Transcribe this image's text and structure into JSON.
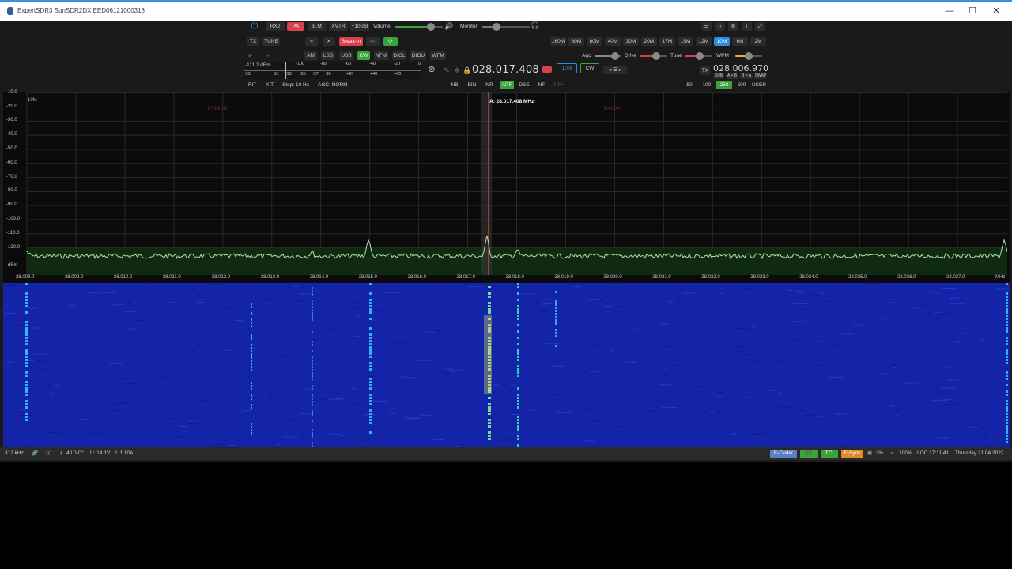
{
  "window": {
    "title": "ExpertSDR3 SunSDR2DX EED06121000318",
    "minimize": "—",
    "maximize": "☐",
    "close": "✕"
  },
  "row1": {
    "rx2": "RX2",
    "pa": "PA",
    "bm": "B.M",
    "xvtr": "XVTR",
    "db": "+10 dB",
    "volume_label": "Volume",
    "volume_level": 0.75,
    "monitor_label": "Monitor",
    "monitor_level": 0.3
  },
  "row2": {
    "tx": "TX",
    "tune": "TUNE",
    "breakin": "Break-in",
    "bands": [
      "160M",
      "80M",
      "60M",
      "40M",
      "30M",
      "20M",
      "17M",
      "15M",
      "12M",
      "10M",
      "6M",
      "2M"
    ],
    "active_band": "10M"
  },
  "row3": {
    "modes": [
      "AM",
      "LSB",
      "USB",
      "CW",
      "NFM",
      "DIGL",
      "DIGU",
      "WFM"
    ],
    "active_mode": "CW",
    "agc_label": "Agc",
    "agc_level": 0.75,
    "drive_label": "Drive",
    "drive_level": 0.6,
    "tune_label": "Tune",
    "tune_level": 0.55,
    "wpm_label": "WPM",
    "wpm_level": 0.5
  },
  "meter": {
    "dbm": "-111.2 dBm",
    "top_scale": [
      "-100",
      "-80",
      "-60",
      "-40",
      "-20",
      "0"
    ],
    "bottom_scale": [
      "S3",
      "S1",
      "S3",
      "S5",
      "S7",
      "S9",
      "+20",
      "+40",
      "+60"
    ]
  },
  "vfo_a": {
    "freq": "028.017.408",
    "band": "10M",
    "mode": "CW"
  },
  "vfo_b": {
    "freq": "028.006.970",
    "sub": "SUB",
    "ab": "A > B",
    "ba": "B > A",
    "swap": "SWAP",
    "tx": "TX"
  },
  "row4": {
    "rit": "RIT",
    "xit": "XIT",
    "step": "Step: 10 Hz",
    "agc": "AGC: NORM",
    "filters": [
      "NB",
      "BIN",
      "NR",
      "APF",
      "DSE",
      "NF",
      "NF+"
    ],
    "active_filter": "APF",
    "bandwidths": [
      "50",
      "100",
      "250",
      "500",
      "USER"
    ],
    "active_bandwidth": "250"
  },
  "spectrum": {
    "band_label": "10M",
    "marker": "A: 28.017.408 MHz",
    "left_tag": "PY1SUN",
    "right_tag": "DA0DX",
    "unit": "dBm",
    "mhz": "MHz",
    "y_ticks": [
      "-10.0",
      "-20.0",
      "-30.0",
      "-40.0",
      "-50.0",
      "-60.0",
      "-70.0",
      "-80.0",
      "-90.0",
      "-100.0",
      "-110.0",
      "-120.0"
    ],
    "x_ticks": [
      "28.008.0",
      "28.009.0",
      "28.010.0",
      "28.011.0",
      "28.012.0",
      "28.013.0",
      "28.014.0",
      "28.015.0",
      "28.016.0",
      "28.017.0",
      "28.018.0",
      "28.019.0",
      "28.020.0",
      "28.021.0",
      "28.022.0",
      "28.023.0",
      "28.024.0",
      "28.025.0",
      "28.026.0",
      "28.027.0"
    ]
  },
  "status": {
    "span": "312 kHz",
    "temp": "40.0 C°",
    "voltage": "U: 14.1V",
    "current": "I: 1.10A",
    "ecoder": "E-Coder",
    "tci": "TCI",
    "esync": "E-Sync",
    "cpu": "3%",
    "zoom": "100%",
    "clock": "LOC 17:11:41",
    "date": "Thursday 21.04.2022"
  },
  "colors": {
    "accent_red": "#d9404c",
    "accent_green": "#3aa33a",
    "accent_blue": "#2f8de0",
    "waterfall": "#1324a8",
    "trace": "#a8e6a8"
  }
}
